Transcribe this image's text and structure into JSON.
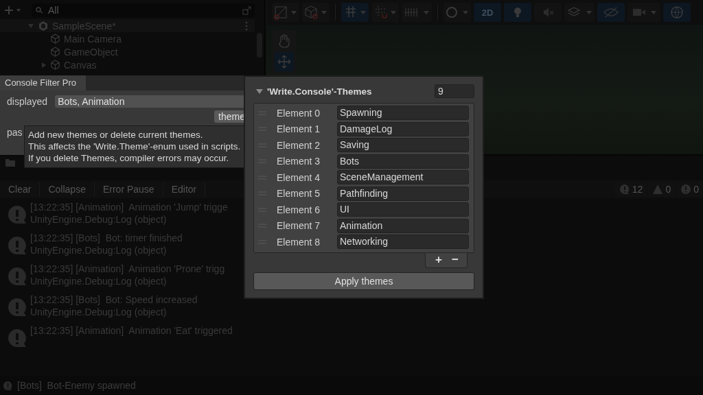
{
  "hierarchy": {
    "search": {
      "placeholder": "All"
    },
    "scene": {
      "name": "SampleScene*",
      "expanded": true
    },
    "items": [
      {
        "name": "Main Camera",
        "kind": "leaf"
      },
      {
        "name": "GameObject",
        "kind": "leaf"
      },
      {
        "name": "Canvas",
        "kind": "collapsed"
      }
    ]
  },
  "scene_toolbar": {
    "mode_2d": {
      "label": "2D",
      "selected": true
    }
  },
  "filter_window": {
    "tab": "Console Filter Pro",
    "displayed_label": "displayed",
    "displayed_value": "Bots, Animation",
    "themes_button": "theme",
    "row_label": "pas"
  },
  "tooltip": {
    "lines": [
      "Add new themes or delete current themes.",
      "This affects the 'Write.Theme'-enum used in scripts.",
      "If you delete Themes, compiler errors may occur."
    ]
  },
  "console": {
    "toolbar": [
      "Clear",
      "Collapse",
      "Error Pause",
      "Editor"
    ],
    "counts": [
      {
        "kind": "log",
        "count": "12"
      },
      {
        "kind": "warning",
        "count": "0"
      },
      {
        "kind": "error",
        "count": "0"
      }
    ],
    "entries": [
      {
        "message": "[13:22:35] [Animation]  Animation 'Jump' trigge",
        "trace": "UnityEngine.Debug:Log (object)"
      },
      {
        "message": "[13:22:35] [Bots]  Bot: timer finished",
        "trace": "UnityEngine.Debug:Log (object)"
      },
      {
        "message": "[13:22:35] [Animation]  Animation 'Prone' trigg",
        "trace": "UnityEngine.Debug:Log (object)"
      },
      {
        "message": "[13:22:35] [Bots]  Bot: Speed increased",
        "trace": "UnityEngine.Debug:Log (object)"
      },
      {
        "message": "[13:22:35] [Animation]  Animation 'Eat' triggered"
      }
    ]
  },
  "status_bar": {
    "message": "[Bots]  Bot-Enemy spawned"
  },
  "themes_popup": {
    "title": "'Write.Console'-Themes",
    "expanded": true,
    "count": "9",
    "elements": [
      {
        "label": "Element 0",
        "value": "Spawning"
      },
      {
        "label": "Element 1",
        "value": "DamageLog"
      },
      {
        "label": "Element 2",
        "value": "Saving"
      },
      {
        "label": "Element 3",
        "value": "Bots"
      },
      {
        "label": "Element 4",
        "value": "SceneManagement"
      },
      {
        "label": "Element 5",
        "value": "Pathfinding"
      },
      {
        "label": "Element 6",
        "value": "UI"
      },
      {
        "label": "Element 7",
        "value": "Animation"
      },
      {
        "label": "Element 8",
        "value": "Networking"
      }
    ],
    "add": "+",
    "remove": "−",
    "apply_button": "Apply themes"
  }
}
